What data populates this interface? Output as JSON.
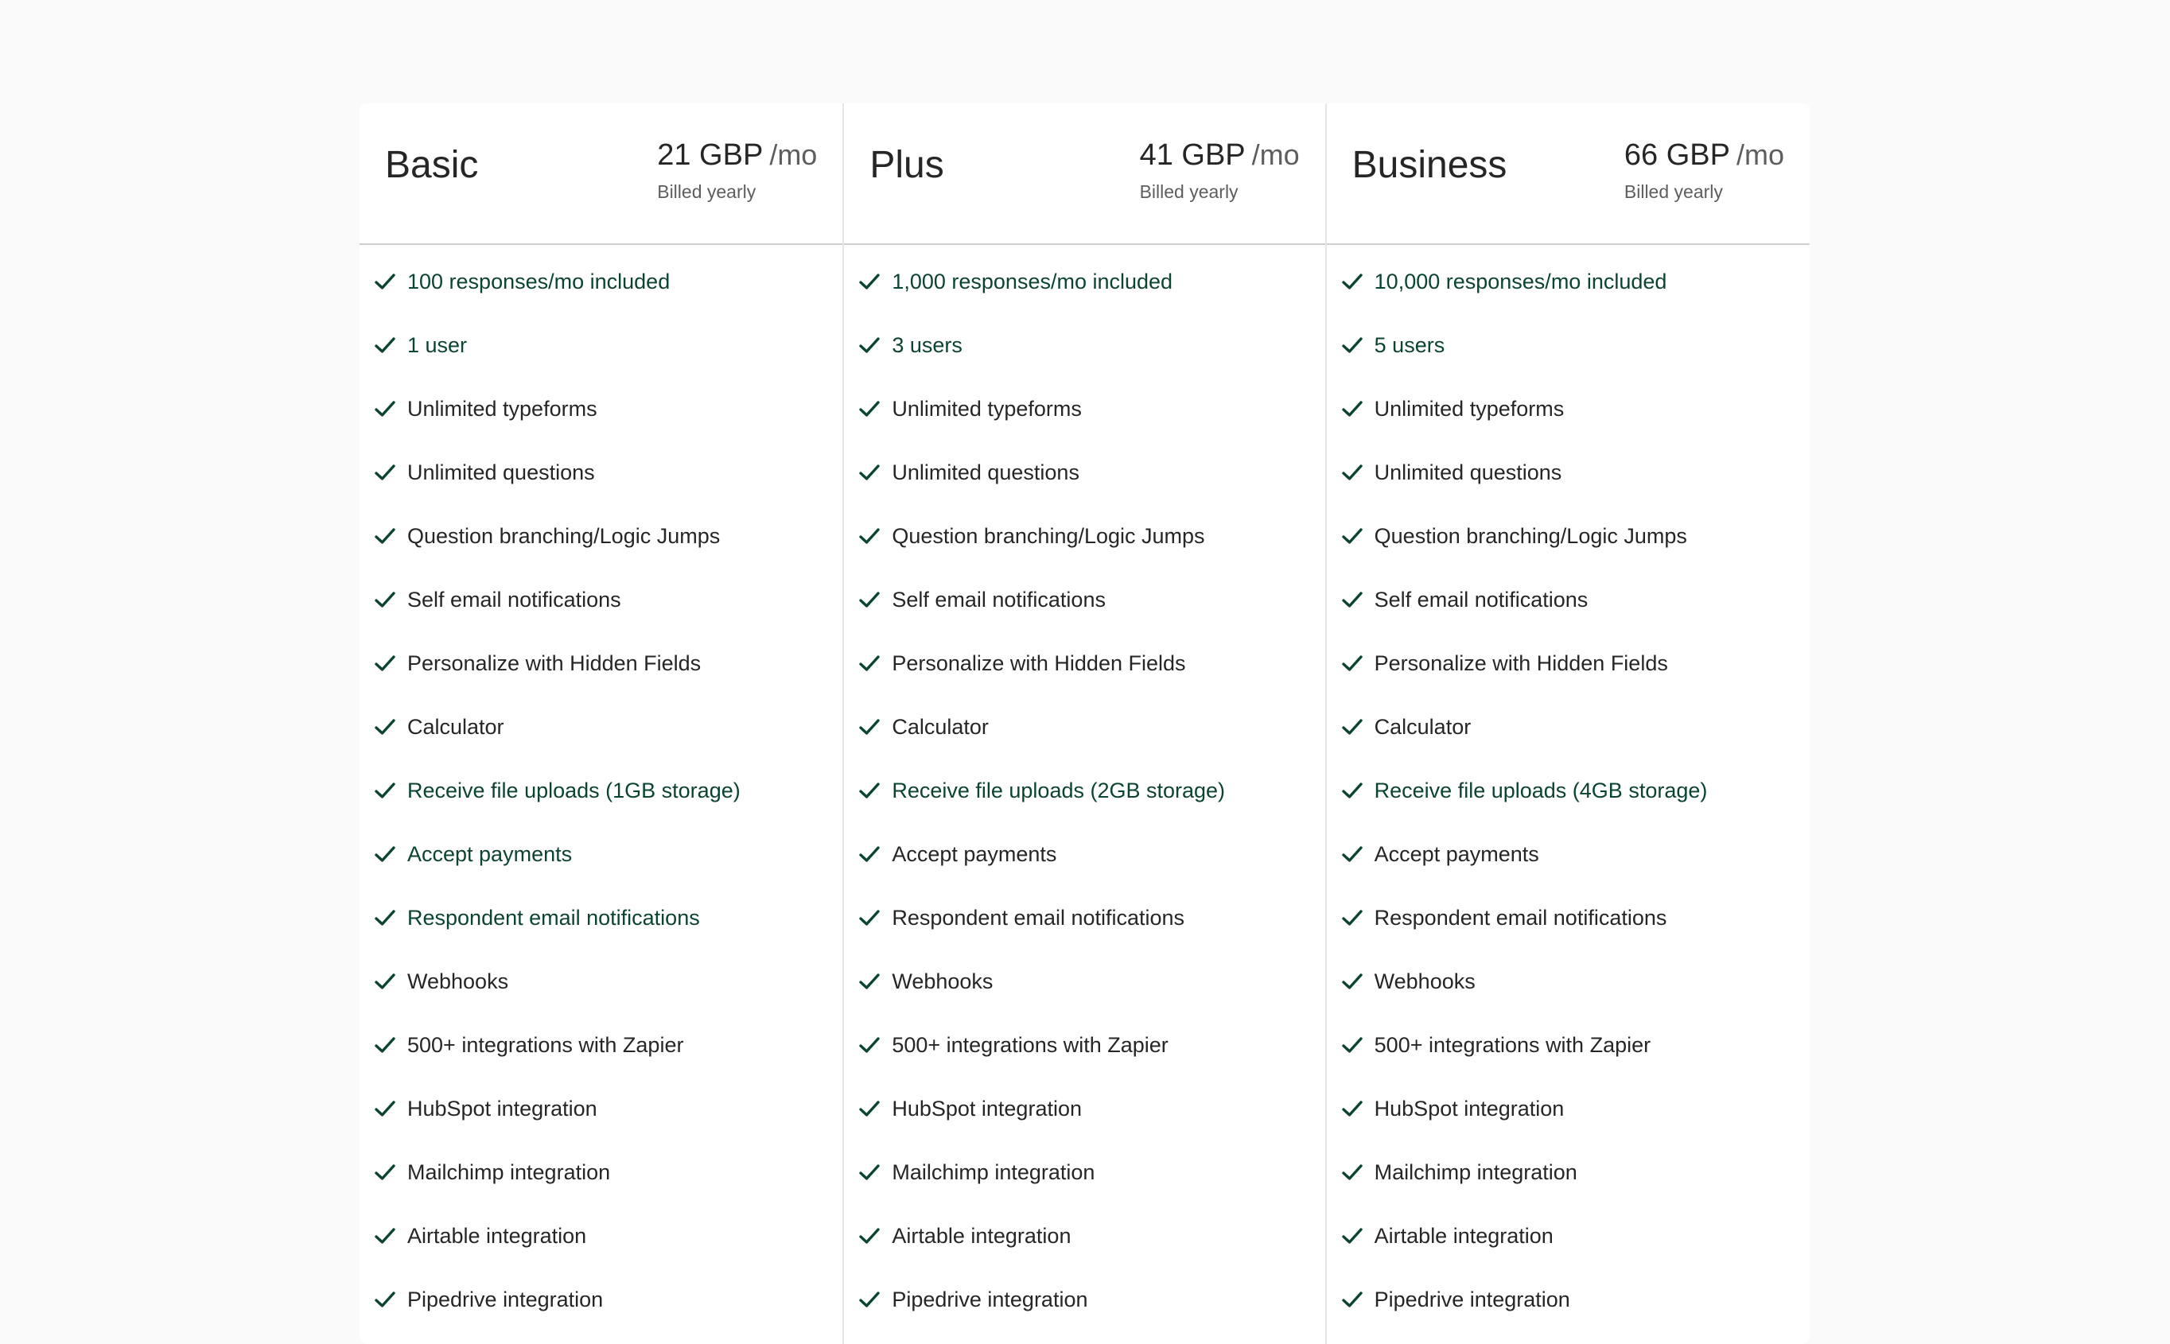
{
  "accent_color": "#0b4430",
  "plans": [
    {
      "name": "Basic",
      "price": "21 GBP",
      "period": "/mo",
      "billing": "Billed yearly",
      "features": [
        {
          "label": "100 responses/mo included",
          "highlight": true
        },
        {
          "label": "1 user",
          "highlight": true
        },
        {
          "label": "Unlimited typeforms",
          "highlight": false
        },
        {
          "label": "Unlimited questions",
          "highlight": false
        },
        {
          "label": "Question branching/Logic Jumps",
          "highlight": false
        },
        {
          "label": "Self email notifications",
          "highlight": false
        },
        {
          "label": "Personalize with Hidden Fields",
          "highlight": false
        },
        {
          "label": "Calculator",
          "highlight": false
        },
        {
          "label": "Receive file uploads (1GB storage)",
          "highlight": true
        },
        {
          "label": "Accept payments",
          "highlight": true
        },
        {
          "label": "Respondent email notifications",
          "highlight": true
        },
        {
          "label": "Webhooks",
          "highlight": false
        },
        {
          "label": "500+ integrations with Zapier",
          "highlight": false
        },
        {
          "label": "HubSpot integration",
          "highlight": false
        },
        {
          "label": "Mailchimp integration",
          "highlight": false
        },
        {
          "label": "Airtable integration",
          "highlight": false
        },
        {
          "label": "Pipedrive integration",
          "highlight": false
        }
      ]
    },
    {
      "name": "Plus",
      "price": "41 GBP",
      "period": "/mo",
      "billing": "Billed yearly",
      "features": [
        {
          "label": "1,000 responses/mo included",
          "highlight": true
        },
        {
          "label": "3 users",
          "highlight": true
        },
        {
          "label": "Unlimited typeforms",
          "highlight": false
        },
        {
          "label": "Unlimited questions",
          "highlight": false
        },
        {
          "label": "Question branching/Logic Jumps",
          "highlight": false
        },
        {
          "label": "Self email notifications",
          "highlight": false
        },
        {
          "label": "Personalize with Hidden Fields",
          "highlight": false
        },
        {
          "label": "Calculator",
          "highlight": false
        },
        {
          "label": "Receive file uploads (2GB storage)",
          "highlight": true
        },
        {
          "label": "Accept payments",
          "highlight": false
        },
        {
          "label": "Respondent email notifications",
          "highlight": false
        },
        {
          "label": "Webhooks",
          "highlight": false
        },
        {
          "label": "500+ integrations with Zapier",
          "highlight": false
        },
        {
          "label": "HubSpot integration",
          "highlight": false
        },
        {
          "label": "Mailchimp integration",
          "highlight": false
        },
        {
          "label": "Airtable integration",
          "highlight": false
        },
        {
          "label": "Pipedrive integration",
          "highlight": false
        }
      ]
    },
    {
      "name": "Business",
      "price": "66 GBP",
      "period": "/mo",
      "billing": "Billed yearly",
      "features": [
        {
          "label": "10,000 responses/mo included",
          "highlight": true
        },
        {
          "label": "5 users",
          "highlight": true
        },
        {
          "label": "Unlimited typeforms",
          "highlight": false
        },
        {
          "label": "Unlimited questions",
          "highlight": false
        },
        {
          "label": "Question branching/Logic Jumps",
          "highlight": false
        },
        {
          "label": "Self email notifications",
          "highlight": false
        },
        {
          "label": "Personalize with Hidden Fields",
          "highlight": false
        },
        {
          "label": "Calculator",
          "highlight": false
        },
        {
          "label": "Receive file uploads (4GB storage)",
          "highlight": true
        },
        {
          "label": "Accept payments",
          "highlight": false
        },
        {
          "label": "Respondent email notifications",
          "highlight": false
        },
        {
          "label": "Webhooks",
          "highlight": false
        },
        {
          "label": "500+ integrations with Zapier",
          "highlight": false
        },
        {
          "label": "HubSpot integration",
          "highlight": false
        },
        {
          "label": "Mailchimp integration",
          "highlight": false
        },
        {
          "label": "Airtable integration",
          "highlight": false
        },
        {
          "label": "Pipedrive integration",
          "highlight": false
        }
      ]
    }
  ]
}
